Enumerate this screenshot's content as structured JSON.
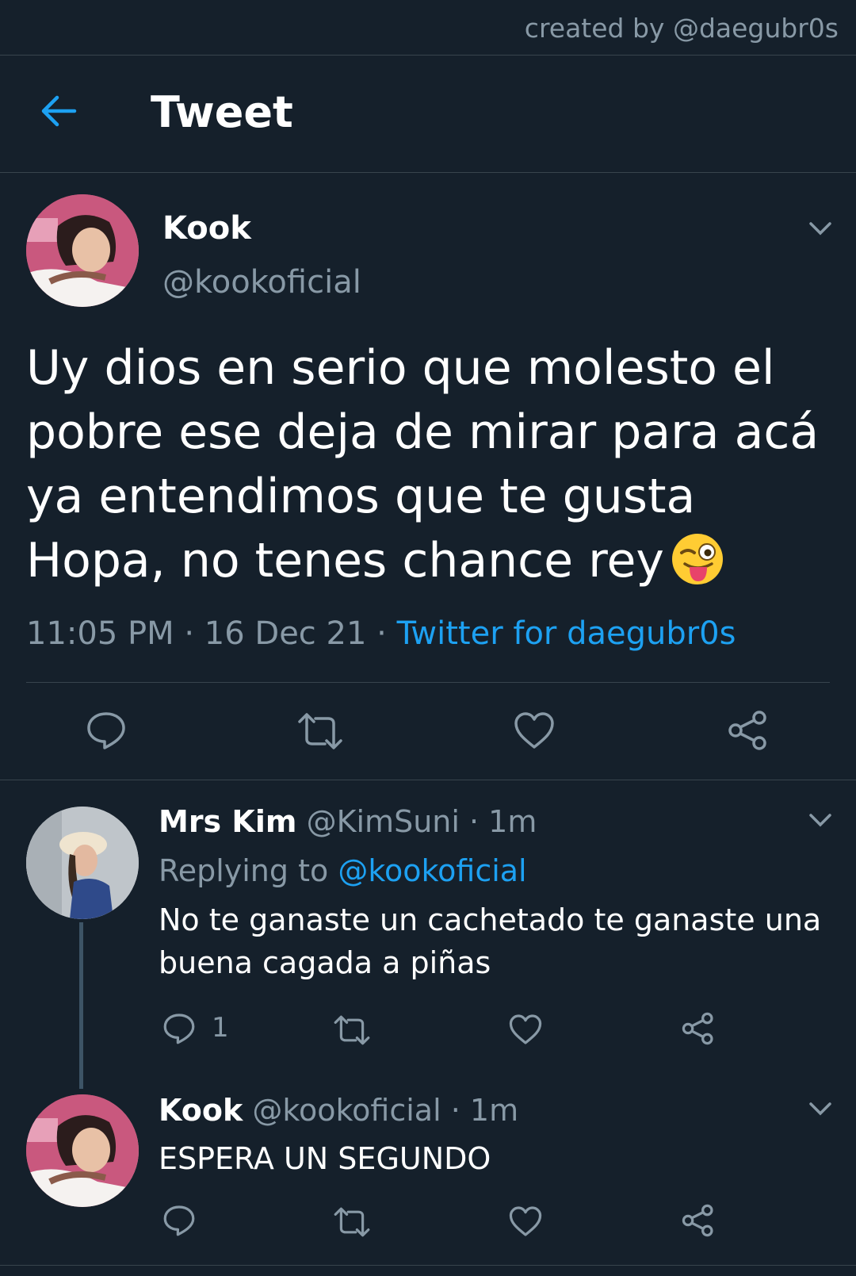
{
  "credit": "created by @daegubr0s",
  "header": {
    "title": "Tweet"
  },
  "tweet": {
    "name": "Kook",
    "handle": "@kookoficial",
    "text": "Uy dios en serio que molesto el pobre ese deja de mirar para acá ya entendimos que te gusta Hopa, no tenes chance rey",
    "emoji": "winking-face-with-tongue",
    "time": "11:05 PM",
    "date": "16 Dec 21",
    "source": "Twitter for daegubr0s",
    "dot": "·"
  },
  "replies": [
    {
      "name": "Mrs Kim",
      "handle": "@KimSuni",
      "age": "· 1m",
      "replying_prefix": "Replying to",
      "replying_to": "@kookoficial",
      "text": "No te ganaste un cachetado te ganaste una buena cagada a piñas",
      "reply_count": "1"
    },
    {
      "name": "Kook",
      "handle": "@kookoficial",
      "age": "· 1m",
      "text": "ESPERA UN SEGUNDO"
    }
  ],
  "colors": {
    "background": "#15202b",
    "accent": "#1da1f2",
    "muted": "#8899a6",
    "divider": "#38444d"
  }
}
